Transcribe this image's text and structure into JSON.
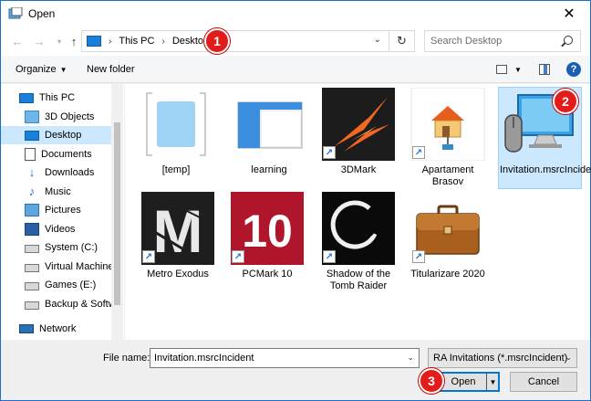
{
  "window": {
    "title": "Open",
    "close_icon": "close-icon"
  },
  "nav": {
    "breadcrumb": [
      "This PC",
      "Desktop"
    ],
    "search_placeholder": "Search Desktop"
  },
  "badges": [
    "1",
    "2",
    "3"
  ],
  "toolbar": {
    "organize": "Organize",
    "new_folder": "New folder",
    "help": "?"
  },
  "sidebar": {
    "items": [
      {
        "label": "This PC",
        "icon": "pc-icon"
      },
      {
        "label": "3D Objects",
        "icon": "3d-objects-icon"
      },
      {
        "label": "Desktop",
        "icon": "desktop-icon",
        "selected": true
      },
      {
        "label": "Documents",
        "icon": "documents-icon"
      },
      {
        "label": "Downloads",
        "icon": "downloads-icon"
      },
      {
        "label": "Music",
        "icon": "music-icon"
      },
      {
        "label": "Pictures",
        "icon": "pictures-icon"
      },
      {
        "label": "Videos",
        "icon": "videos-icon"
      },
      {
        "label": "System (C:)",
        "icon": "drive-icon"
      },
      {
        "label": "Virtual Machines",
        "icon": "drive-icon"
      },
      {
        "label": "Games (E:)",
        "icon": "drive-icon"
      },
      {
        "label": "Backup & Softw",
        "icon": "drive-icon"
      },
      {
        "label": "Network",
        "icon": "network-icon"
      }
    ]
  },
  "files": [
    {
      "label": "[temp]",
      "icon": "folder-icon"
    },
    {
      "label": "learning",
      "icon": "folder-icon"
    },
    {
      "label": "3DMark",
      "icon": "3dmark-icon",
      "shortcut": true
    },
    {
      "label": "Apartament Brasov",
      "icon": "network-home-icon",
      "shortcut": true
    },
    {
      "label": "Invitation.msrcIncident",
      "icon": "remote-assistance-icon",
      "selected": true
    },
    {
      "label": "Metro Exodus",
      "icon": "metro-exodus-icon",
      "shortcut": true
    },
    {
      "label": "PCMark 10",
      "icon": "pcmark10-icon",
      "shortcut": true
    },
    {
      "label": "Shadow of the Tomb Raider",
      "icon": "tomb-raider-icon",
      "shortcut": true
    },
    {
      "label": "Titularizare 2020",
      "icon": "briefcase-icon",
      "shortcut": true
    }
  ],
  "pcmark_text": "10",
  "metro_text": "M",
  "bottom": {
    "file_name_label": "File name:",
    "file_name_value": "Invitation.msrcIncident",
    "file_type": "RA Invitations (*.msrcIncident)",
    "open_label": "Open",
    "cancel_label": "Cancel"
  }
}
